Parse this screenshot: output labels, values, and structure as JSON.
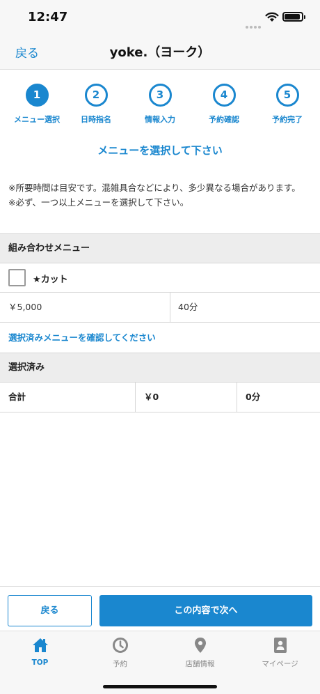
{
  "status_bar": {
    "time": "12:47"
  },
  "nav": {
    "back_label": "戻る",
    "title": "yoke.（ヨーク）"
  },
  "steps": [
    {
      "number": "1",
      "label": "メニュー選択"
    },
    {
      "number": "2",
      "label": "日時指名"
    },
    {
      "number": "3",
      "label": "情報入力"
    },
    {
      "number": "4",
      "label": "予約確認"
    },
    {
      "number": "5",
      "label": "予約完了"
    }
  ],
  "instruction": "メニューを選択して下さい",
  "notes": [
    "※所要時間は目安です。混雑具合などにより、多少異なる場合があります。",
    "※必ず、一つ以上メニューを選択して下さい。"
  ],
  "combo_section": {
    "header": "組み合わせメニュー",
    "items": [
      {
        "name": "★カット",
        "price": "￥5,000",
        "duration": "40分"
      }
    ]
  },
  "confirm_link": "選択済みメニューを確認してください",
  "selected_section": {
    "header": "選択済み",
    "total_label": "合計",
    "total_price": "￥0",
    "total_duration": "0分"
  },
  "actions": {
    "back_label": "戻る",
    "next_label": "この内容で次へ"
  },
  "tabs": [
    {
      "label": "TOP",
      "icon": "home-icon"
    },
    {
      "label": "予約",
      "icon": "clock-icon"
    },
    {
      "label": "店舗情報",
      "icon": "map-pin-icon"
    },
    {
      "label": "マイページ",
      "icon": "user-card-icon"
    }
  ],
  "colors": {
    "accent": "#1a87cf",
    "tab_inactive": "#888888",
    "header_bg": "#ededed"
  }
}
